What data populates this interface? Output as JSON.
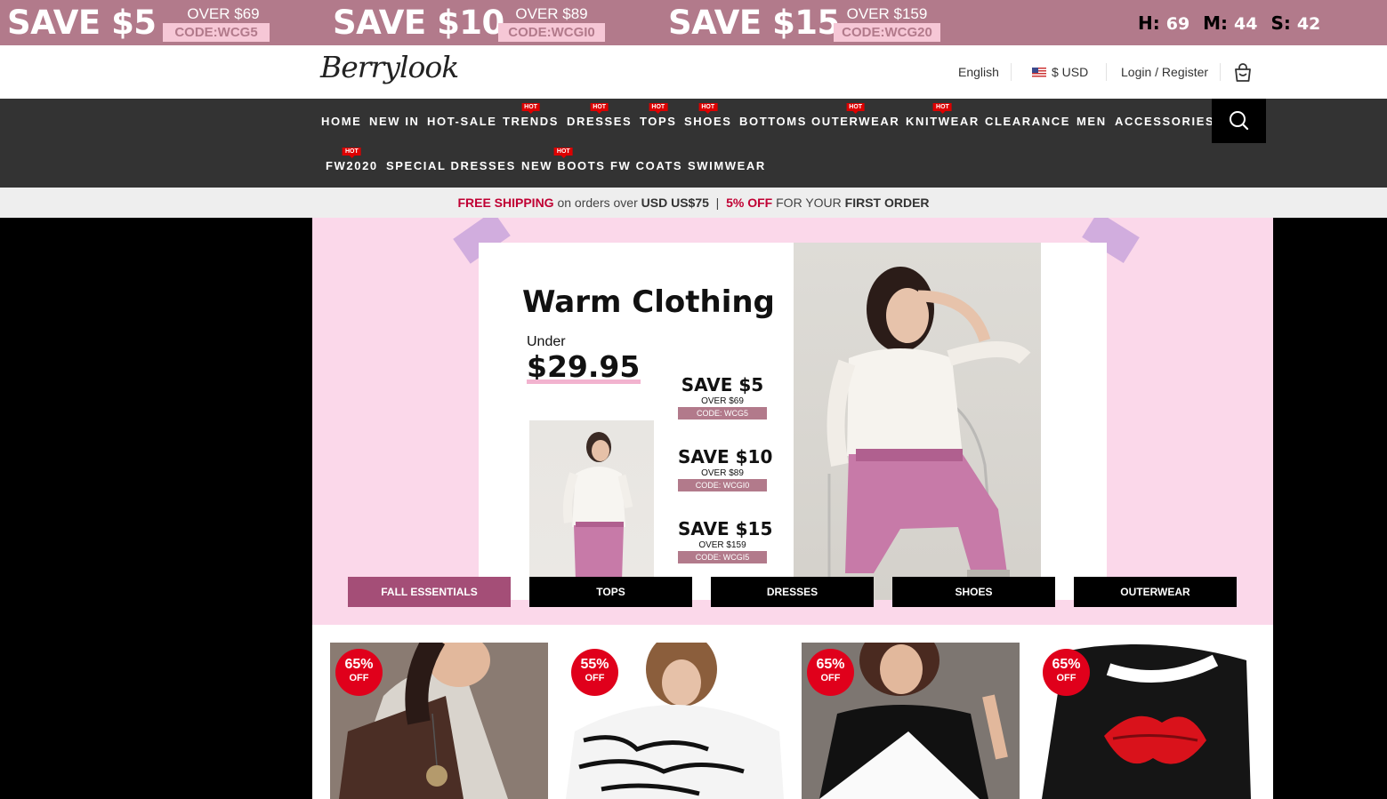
{
  "promo_bar": {
    "offers": [
      {
        "save": "SAVE $5",
        "over": "OVER $69",
        "code": "CODE:WCG5"
      },
      {
        "save": "SAVE $10",
        "over": "OVER $89",
        "code": "CODE:WCGI0"
      },
      {
        "save": "SAVE $15",
        "over": "OVER $159",
        "code": "CODE:WCG20"
      }
    ],
    "countdown": {
      "h_label": "H:",
      "h": "69",
      "m_label": "M:",
      "m": "44",
      "s_label": "S:",
      "s": "42"
    },
    "colors": {
      "bar": "#b27a8b",
      "code_bg": "#f6c7d6"
    }
  },
  "header": {
    "logo": "Berrylook",
    "language": "English",
    "currency": "$ USD",
    "login": "Login / Register",
    "cart_icon": "shopping-bag-icon"
  },
  "nav": {
    "row1": [
      {
        "label": "HOME",
        "hot": false
      },
      {
        "label": "NEW IN",
        "hot": false
      },
      {
        "label": "HOT-SALE",
        "hot": false
      },
      {
        "label": "TRENDS",
        "hot": true
      },
      {
        "label": "DRESSES",
        "hot": true
      },
      {
        "label": "TOPS",
        "hot": true
      },
      {
        "label": "SHOES",
        "hot": true
      },
      {
        "label": "BOTTOMS",
        "hot": false
      },
      {
        "label": "OUTERWEAR",
        "hot": true
      },
      {
        "label": "KNITWEAR",
        "hot": true
      },
      {
        "label": "CLEARANCE",
        "hot": false
      },
      {
        "label": "MEN",
        "hot": false
      },
      {
        "label": "ACCESSORIES",
        "hot": false
      }
    ],
    "row2": [
      {
        "label": "FW2020",
        "hot": true
      },
      {
        "label": "SPECIAL DRESSES",
        "hot": false
      },
      {
        "label": "NEW BOOTS",
        "hot": true
      },
      {
        "label": "FW COATS",
        "hot": false
      },
      {
        "label": "SWIMWEAR",
        "hot": false
      }
    ],
    "hot_label": "HOT",
    "search_icon": "search-icon"
  },
  "shipping": {
    "free": "FREE SHIPPING",
    "on_orders": " on orders over ",
    "amount": "USD US$75",
    "sep": "  |  ",
    "pct": "5% OFF",
    "for_your": " FOR YOUR ",
    "first": "FIRST ORDER"
  },
  "banner": {
    "title": "Warm Clothing",
    "under": "Under",
    "price": "$29.95",
    "offers": [
      {
        "save": "SAVE $5",
        "over": "OVER $69",
        "code": "CODE:  WCG5"
      },
      {
        "save": "SAVE $10",
        "over": "OVER $89",
        "code": "CODE: WCGI0"
      },
      {
        "save": "SAVE $15",
        "over": "OVER $159",
        "code": "CODE:  WCGI5"
      }
    ],
    "tabs": [
      {
        "label": "FALL ESSENTIALS",
        "active": true
      },
      {
        "label": "TOPS",
        "active": false
      },
      {
        "label": "DRESSES",
        "active": false
      },
      {
        "label": "SHOES",
        "active": false
      },
      {
        "label": "OUTERWEAR",
        "active": false
      }
    ],
    "colors": {
      "bg": "#fbd8ea",
      "active_tab": "#a44e77"
    }
  },
  "products": [
    {
      "discount": "65%",
      "off": "OFF"
    },
    {
      "discount": "55%",
      "off": "OFF"
    },
    {
      "discount": "65%",
      "off": "OFF"
    },
    {
      "discount": "65%",
      "off": "OFF"
    }
  ]
}
